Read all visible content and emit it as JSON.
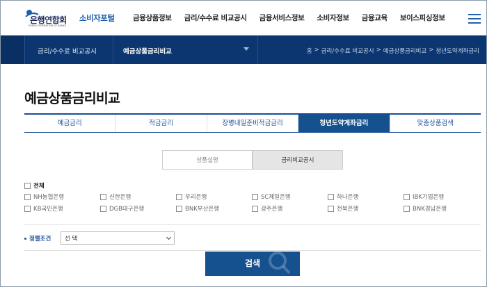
{
  "header": {
    "logo_text": "은행연합회",
    "logo_sub": "KOREA FEDERATION OF BANKS",
    "portal_name": "소비자포털",
    "nav": [
      "금융상품정보",
      "금리/수수료 비교공시",
      "금융서비스정보",
      "소비자정보",
      "금융교육",
      "보이스피싱정보"
    ],
    "menu_icon": "hamburger-icon"
  },
  "subnav": {
    "category": "금리/수수료 비교공시",
    "page": "예금상품금리비교",
    "caret_icon": "chevron-down-icon",
    "breadcrumb": [
      "홈",
      ">",
      "금리/수수료 비교공시",
      ">",
      "예금상품금리비교",
      ">",
      "청년도약계좌금리"
    ]
  },
  "page_title": "예금상품금리비교",
  "tabs": [
    {
      "label": "예금금리",
      "active": false
    },
    {
      "label": "적금금리",
      "active": false
    },
    {
      "label": "장병내일준비적금금리",
      "active": false
    },
    {
      "label": "청년도약계좌금리",
      "active": true
    },
    {
      "label": "맞춤상품검색",
      "active": false
    }
  ],
  "subtabs": [
    {
      "label": "상품설명",
      "active": false
    },
    {
      "label": "금리비교공시",
      "active": true
    }
  ],
  "filter": {
    "all_label": "전체",
    "banks": [
      "NH농협은행",
      "신한은행",
      "우리은행",
      "SC제일은행",
      "하나은행",
      "IBK기업은행",
      "KB국민은행",
      "DGB대구은행",
      "BNK부산은행",
      "광주은행",
      "전북은행",
      "BNK경남은행"
    ]
  },
  "sort": {
    "label": "정렬조건",
    "selected": "선 택"
  },
  "search": {
    "label": "검색",
    "icon": "magnifier-icon"
  },
  "colors": {
    "primary": "#15508f",
    "subnav": "#0b3670",
    "brand_text": "#1f5fae"
  }
}
